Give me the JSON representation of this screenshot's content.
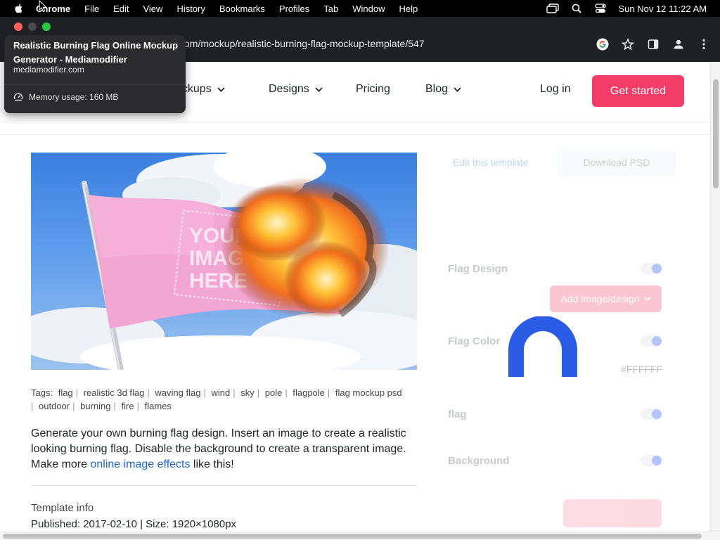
{
  "menubar": {
    "app": "Chrome",
    "items": [
      "File",
      "Edit",
      "View",
      "History",
      "Bookmarks",
      "Profiles",
      "Tab",
      "Window",
      "Help"
    ],
    "clock": "Sun Nov 12  11:22 AM"
  },
  "browser": {
    "address_text": "om/mockup/realistic-burning-flag-mockup-template/547",
    "traffic_colors": [
      "#ff5f57",
      "#febc2e",
      "#28c840"
    ]
  },
  "tab_tooltip": {
    "title": "Realistic Burning Flag Online Mockup Generator - Mediamodifier",
    "domain": "mediamodifier.com",
    "memory": "Memory usage: 160 MB"
  },
  "nav": {
    "mockups": "ockups",
    "designs": "Designs",
    "pricing": "Pricing",
    "blog": "Blog",
    "login": "Log in",
    "cta": "Get started",
    "accent": "#f43c68"
  },
  "content": {
    "tags_label": "Tags:",
    "tags": [
      "flag",
      "realistic 3d flag",
      "waving flag",
      "wind",
      "sky",
      "pole",
      "flagpole",
      "flag mockup psd",
      "outdoor",
      "burning",
      "fire",
      "flames"
    ],
    "desc_pre": "Generate your own burning flag design. Insert an image to create a realistic looking burning flag. Disable the background to create a transparent image. Make more ",
    "desc_link": "online image effects",
    "desc_post": " like this!",
    "template_info": "Template info",
    "published": "Published: 2017-02-10 | Size: 1920×1080px",
    "placeholder_lines": [
      "YOUR",
      "IMAGE",
      "HERE"
    ]
  },
  "panel": {
    "edit": "Edit this template",
    "download": "Download PSD",
    "flag_design": "Flag Design",
    "add_image": "Add image/design",
    "flag_color": "Flag Color",
    "hex": "#FFFFFF",
    "flag": "flag",
    "background": "Background"
  }
}
